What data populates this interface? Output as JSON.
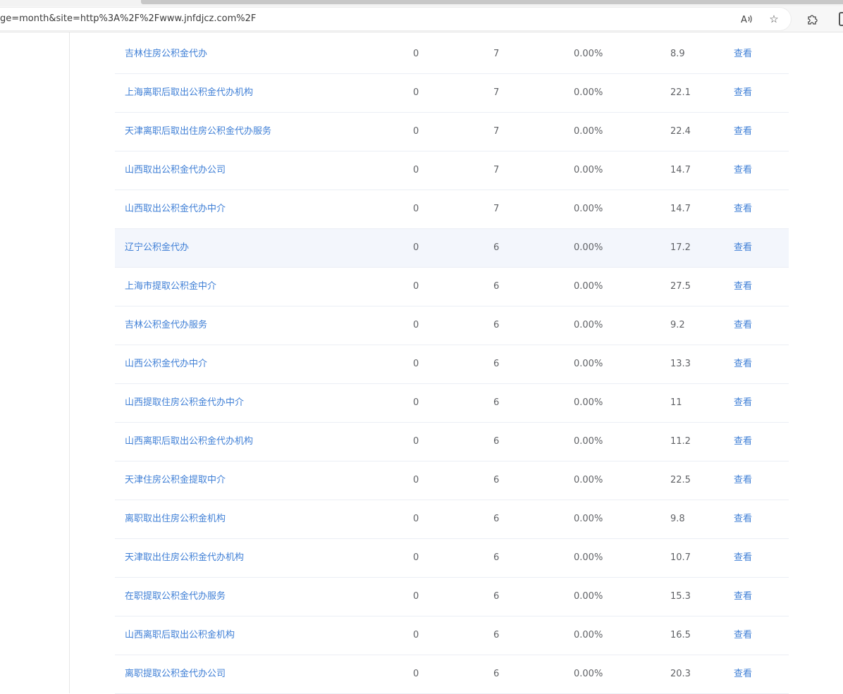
{
  "browser": {
    "url_fragment": "ge=month&site=http%3A%2F%2Fwww.jnfdjcz.com%2F",
    "read_aloud_icon": "read-aloud-icon",
    "favorite_icon": "star-icon",
    "extensions_icon": "puzzle-icon"
  },
  "table": {
    "rows": [
      {
        "keyword": "吉林住房公积金代办",
        "col1": "0",
        "col2": "7",
        "col3": "0.00%",
        "col4": "8.9",
        "action": "查看"
      },
      {
        "keyword": "上海离职后取出公积金代办机构",
        "col1": "0",
        "col2": "7",
        "col3": "0.00%",
        "col4": "22.1",
        "action": "查看"
      },
      {
        "keyword": "天津离职后取出住房公积金代办服务",
        "col1": "0",
        "col2": "7",
        "col3": "0.00%",
        "col4": "22.4",
        "action": "查看"
      },
      {
        "keyword": "山西取出公积金代办公司",
        "col1": "0",
        "col2": "7",
        "col3": "0.00%",
        "col4": "14.7",
        "action": "查看"
      },
      {
        "keyword": "山西取出公积金代办中介",
        "col1": "0",
        "col2": "7",
        "col3": "0.00%",
        "col4": "14.7",
        "action": "查看"
      },
      {
        "keyword": "辽宁公积金代办",
        "col1": "0",
        "col2": "6",
        "col3": "0.00%",
        "col4": "17.2",
        "action": "查看"
      },
      {
        "keyword": "上海市提取公积金中介",
        "col1": "0",
        "col2": "6",
        "col3": "0.00%",
        "col4": "27.5",
        "action": "查看"
      },
      {
        "keyword": "吉林公积金代办服务",
        "col1": "0",
        "col2": "6",
        "col3": "0.00%",
        "col4": "9.2",
        "action": "查看"
      },
      {
        "keyword": "山西公积金代办中介",
        "col1": "0",
        "col2": "6",
        "col3": "0.00%",
        "col4": "13.3",
        "action": "查看"
      },
      {
        "keyword": "山西提取住房公积金代办中介",
        "col1": "0",
        "col2": "6",
        "col3": "0.00%",
        "col4": "11",
        "action": "查看"
      },
      {
        "keyword": "山西离职后取出公积金代办机构",
        "col1": "0",
        "col2": "6",
        "col3": "0.00%",
        "col4": "11.2",
        "action": "查看"
      },
      {
        "keyword": "天津住房公积金提取中介",
        "col1": "0",
        "col2": "6",
        "col3": "0.00%",
        "col4": "22.5",
        "action": "查看"
      },
      {
        "keyword": "离职取出住房公积金机构",
        "col1": "0",
        "col2": "6",
        "col3": "0.00%",
        "col4": "9.8",
        "action": "查看"
      },
      {
        "keyword": "天津取出住房公积金代办机构",
        "col1": "0",
        "col2": "6",
        "col3": "0.00%",
        "col4": "10.7",
        "action": "查看"
      },
      {
        "keyword": "在职提取公积金代办服务",
        "col1": "0",
        "col2": "6",
        "col3": "0.00%",
        "col4": "15.3",
        "action": "查看"
      },
      {
        "keyword": "山西离职后取出公积金机构",
        "col1": "0",
        "col2": "6",
        "col3": "0.00%",
        "col4": "16.5",
        "action": "查看"
      },
      {
        "keyword": "离职提取公积金代办公司",
        "col1": "0",
        "col2": "6",
        "col3": "0.00%",
        "col4": "20.3",
        "action": "查看"
      }
    ],
    "highlighted_row": 5
  }
}
